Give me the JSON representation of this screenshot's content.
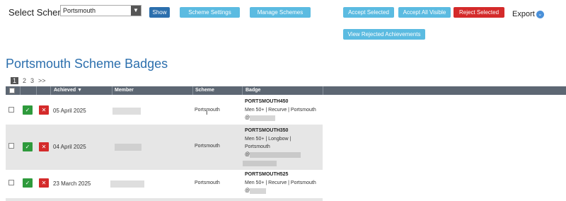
{
  "toolbar": {
    "select_scheme_label": "Select Scheme",
    "selected_scheme": "Portsmouth",
    "show_label": "Show",
    "scheme_settings_label": "Scheme Settings",
    "manage_schemes_label": "Manage Schemes",
    "accept_selected_label": "Accept Selected",
    "accept_all_visible_label": "Accept All Visible",
    "reject_selected_label": "Reject Selected",
    "export_label": "Export",
    "view_rejected_label": "View Rejected Achievements"
  },
  "page_title": "Portsmouth Scheme Badges",
  "pager": {
    "pages": [
      "1",
      "2",
      "3",
      ">>"
    ],
    "current": "1"
  },
  "table": {
    "headers": {
      "achieved": "Achieved",
      "member": "Member",
      "scheme": "Scheme",
      "badge": "Badge"
    },
    "rows": [
      {
        "date": "05 April 2025",
        "scheme": "Portsmouth",
        "badge_title": "PORTSMOUTH450",
        "badge_desc": "Men 50+ | Recurve | Portsmouth",
        "at": "@"
      },
      {
        "date": "04 April 2025",
        "scheme": "Portsmouth",
        "badge_title": "PORTSMOUTH350",
        "badge_desc": "Men 50+ | Longbow | Portsmouth",
        "at": "@"
      },
      {
        "date": "23 March 2025",
        "scheme": "Portsmouth",
        "badge_title": "PORTSMOUTH525",
        "badge_desc": "Men 50+ | Recurve | Portsmouth",
        "at": "@"
      }
    ]
  },
  "colors": {
    "accent": "#2c6fad",
    "light_button": "#5bbbe1",
    "reject": "#d42a2a",
    "accept": "#2e9a3c",
    "header_bg": "#5d6773"
  }
}
